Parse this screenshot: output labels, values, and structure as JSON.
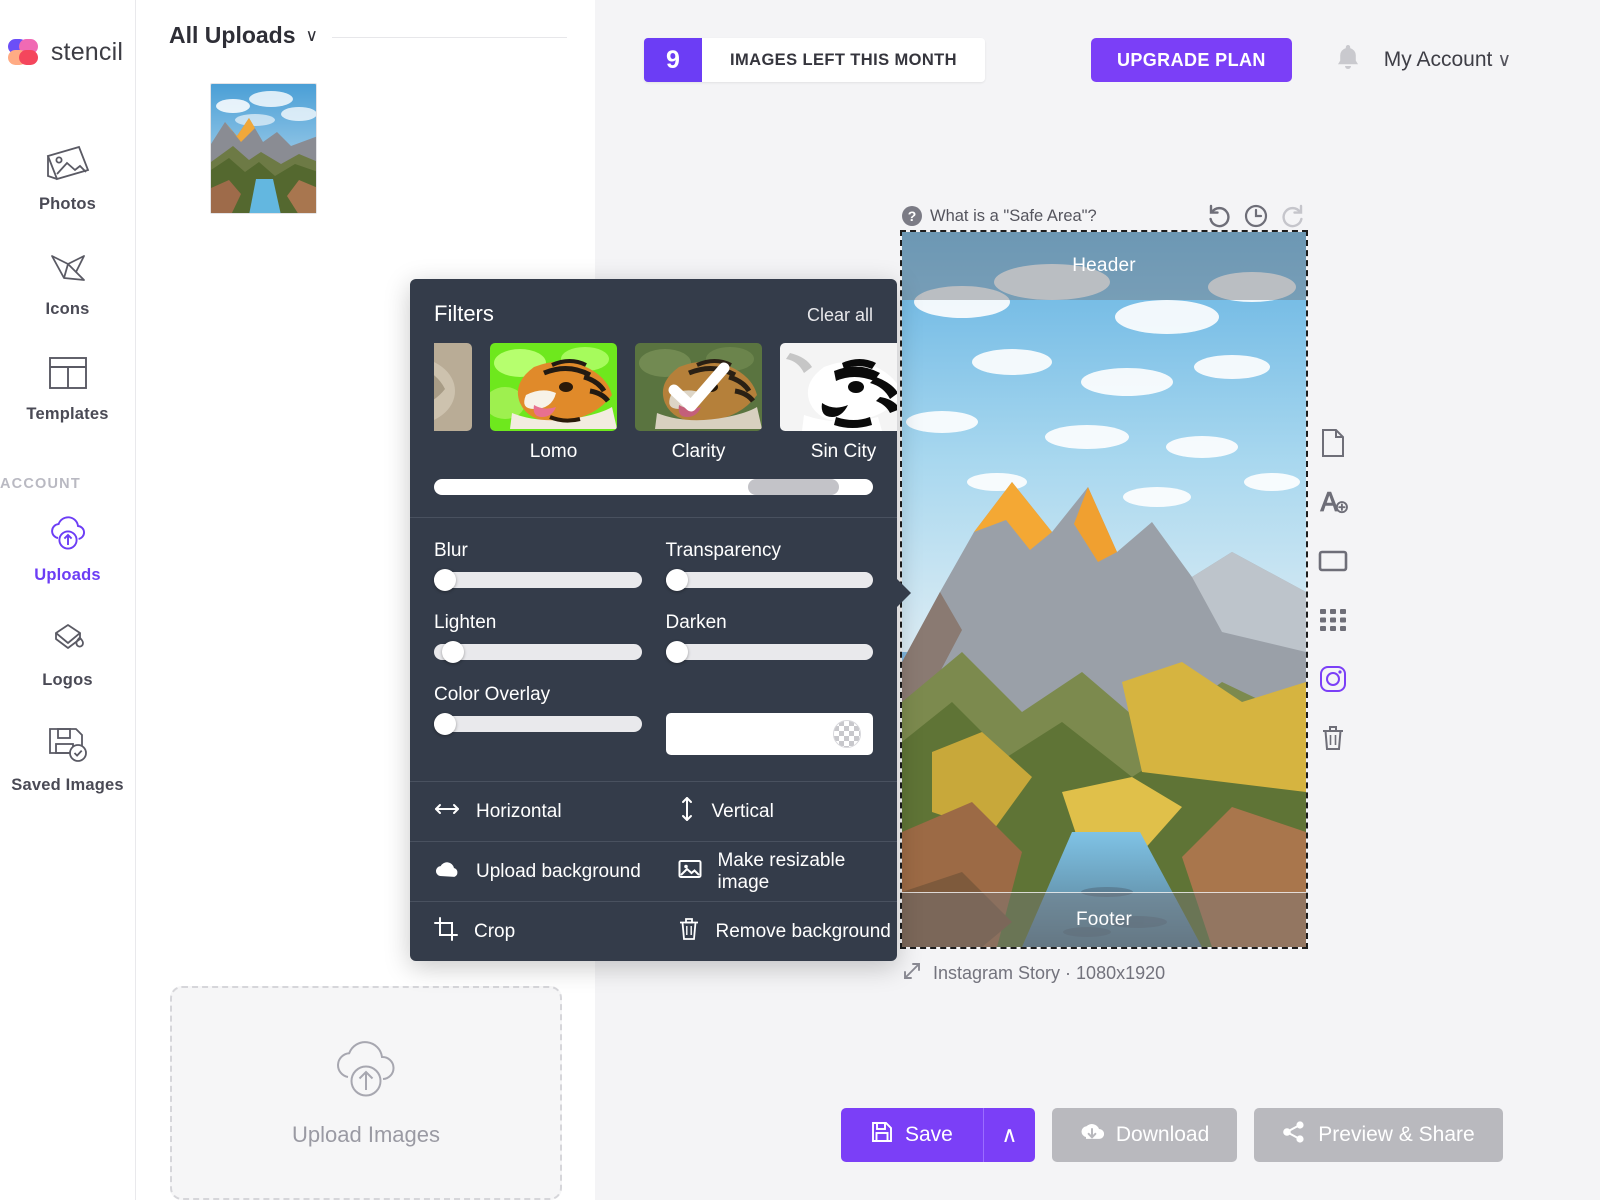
{
  "brand": {
    "name": "stencil"
  },
  "sidebar": {
    "items": [
      {
        "label": "Photos",
        "icon": "photos-icon",
        "active": false
      },
      {
        "label": "Icons",
        "icon": "icons-icon",
        "active": false
      },
      {
        "label": "Templates",
        "icon": "templates-icon",
        "active": false
      }
    ],
    "section_label": "ACCOUNT",
    "account_items": [
      {
        "label": "Uploads",
        "icon": "cloud-upload-icon",
        "active": true
      },
      {
        "label": "Logos",
        "icon": "logos-icon",
        "active": false
      },
      {
        "label": "Saved Images",
        "icon": "saved-images-icon",
        "active": false
      }
    ]
  },
  "uploads": {
    "title": "All Uploads",
    "caret": "∨",
    "dropzone_label": "Upload Images"
  },
  "header": {
    "quota_count": "9",
    "quota_text": "IMAGES LEFT THIS MONTH",
    "upgrade_label": "UPGRADE PLAN",
    "account_label": "My Account",
    "account_caret": "∨"
  },
  "canvas": {
    "safe_area_help": "What is a \"Safe Area\"?",
    "help_glyph": "?",
    "header_band": "Header",
    "footer_band": "Footer",
    "size_label": "Instagram Story · 1080x1920",
    "history_icons": [
      "undo-icon",
      "history-icon",
      "redo-icon"
    ]
  },
  "right_toolbar": {
    "items": [
      {
        "name": "duplicate-page-icon"
      },
      {
        "name": "add-text-icon"
      },
      {
        "name": "add-shape-icon"
      },
      {
        "name": "grid-icon"
      },
      {
        "name": "instagram-icon"
      },
      {
        "name": "delete-icon"
      }
    ],
    "active_color": "#7b3ff7"
  },
  "actions": {
    "save_label": "Save",
    "save_caret": "∧",
    "download_label": "Download",
    "preview_label": "Preview & Share"
  },
  "filters_panel": {
    "title": "Filters",
    "clear_all": "Clear all",
    "thumbnails": [
      {
        "name": "",
        "partial": true,
        "selected": false
      },
      {
        "name": "Lomo",
        "partial": false,
        "selected": false
      },
      {
        "name": "Clarity",
        "partial": false,
        "selected": true
      },
      {
        "name": "Sin City",
        "partial": false,
        "selected": false
      }
    ],
    "sliders": [
      {
        "label": "Blur",
        "value": 0
      },
      {
        "label": "Transparency",
        "value": 0
      },
      {
        "label": "Lighten",
        "value": 4
      },
      {
        "label": "Darken",
        "value": 0
      },
      {
        "label": "Color Overlay",
        "value": 0
      }
    ],
    "color_swatch": "transparent",
    "rows": [
      [
        {
          "label": "Horizontal",
          "icon": "flip-horizontal-icon"
        },
        {
          "label": "Vertical",
          "icon": "flip-vertical-icon"
        }
      ],
      [
        {
          "label": "Upload background",
          "icon": "cloud-upload-icon"
        },
        {
          "label": "Make resizable image",
          "icon": "image-icon"
        }
      ],
      [
        {
          "label": "Crop",
          "icon": "crop-icon"
        },
        {
          "label": "Remove background",
          "icon": "trash-icon"
        }
      ]
    ]
  },
  "colors": {
    "accent": "#7b3ff7",
    "panel": "#343c4a",
    "stage": "#f4f4f6"
  }
}
